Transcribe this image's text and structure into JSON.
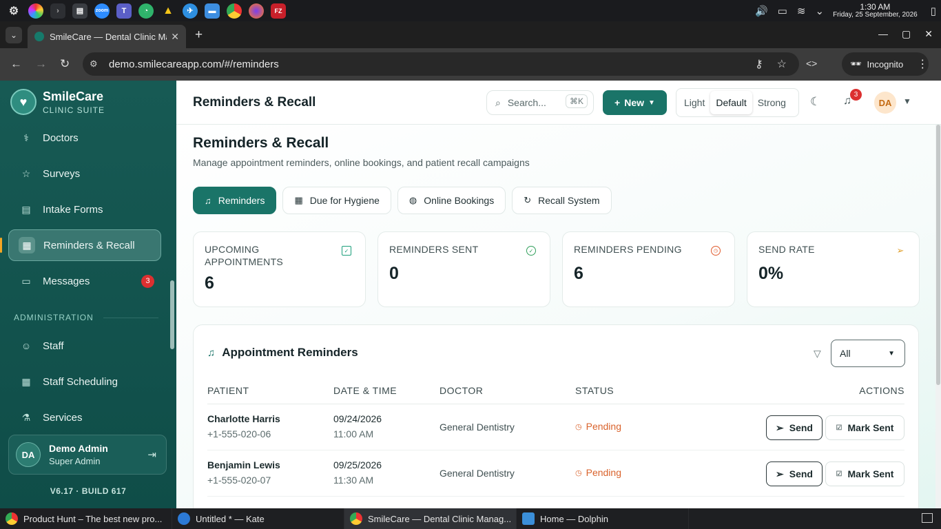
{
  "os": {
    "clock_time": "1:30 AM",
    "clock_date": "Friday, 25 September, 2026"
  },
  "browser": {
    "tab_title": "SmileCare — Dental Clinic Management",
    "url": "demo.smilecareapp.com/#/reminders",
    "incognito_label": "Incognito"
  },
  "sidebar": {
    "brand_name": "SmileCare",
    "brand_sub": "CLINIC SUITE",
    "items": [
      {
        "label": "Doctors",
        "icon": "stethoscope-icon"
      },
      {
        "label": "Surveys",
        "icon": "star-icon"
      },
      {
        "label": "Intake Forms",
        "icon": "clipboard-icon"
      },
      {
        "label": "Reminders & Recall",
        "icon": "calendar-check-icon",
        "active": true
      },
      {
        "label": "Messages",
        "icon": "message-icon",
        "badge": "3"
      }
    ],
    "section_admin": "ADMINISTRATION",
    "admin_items": [
      {
        "label": "Staff",
        "icon": "user-cog-icon"
      },
      {
        "label": "Staff Scheduling",
        "icon": "calendar-icon"
      },
      {
        "label": "Services",
        "icon": "flask-icon"
      }
    ],
    "user": {
      "initials": "DA",
      "name": "Demo Admin",
      "role": "Super Admin"
    },
    "version": "V6.17 · BUILD 617"
  },
  "header": {
    "title": "Reminders & Recall",
    "search_placeholder": "Search...",
    "search_shortcut": "⌘K",
    "new_label": "New",
    "theme_options": [
      "Light",
      "Default",
      "Strong"
    ],
    "theme_selected": "Default",
    "notifications_count": "3",
    "avatar_initials": "DA"
  },
  "page": {
    "title": "Reminders & Recall",
    "subtitle": "Manage appointment reminders, online bookings, and patient recall campaigns",
    "tabs": [
      {
        "label": "Reminders",
        "active": true
      },
      {
        "label": "Due for Hygiene"
      },
      {
        "label": "Online Bookings"
      },
      {
        "label": "Recall System"
      }
    ],
    "stats": [
      {
        "label": "UPCOMING APPOINTMENTS",
        "value": "6",
        "color": "#1a9e7a"
      },
      {
        "label": "REMINDERS SENT",
        "value": "0",
        "color": "#2f9e5a"
      },
      {
        "label": "REMINDERS PENDING",
        "value": "6",
        "color": "#e0592b"
      },
      {
        "label": "SEND RATE",
        "value": "0%",
        "color": "#e0a02b"
      }
    ]
  },
  "reminders_table": {
    "title": "Appointment Reminders",
    "filter_value": "All",
    "columns": [
      "PATIENT",
      "DATE & TIME",
      "DOCTOR",
      "STATUS",
      "ACTIONS"
    ],
    "rows": [
      {
        "name": "Charlotte Harris",
        "phone": "+1-555-020-06",
        "date": "09/24/2026",
        "time": "11:00 AM",
        "doctor": "General Dentistry",
        "status": "Pending"
      },
      {
        "name": "Benjamin Lewis",
        "phone": "+1-555-020-07",
        "date": "09/25/2026",
        "time": "11:30 AM",
        "doctor": "General Dentistry",
        "status": "Pending"
      }
    ],
    "send_label": "Send",
    "mark_label": "Mark Sent"
  },
  "taskbar": [
    {
      "label": "Product Hunt – The best new pro...",
      "color": "#e44d26"
    },
    {
      "label": "Untitled * — Kate",
      "color": "#2c7ad6"
    },
    {
      "label": "SmileCare — Dental Clinic Manag...",
      "color": "#e44d26",
      "active": true
    },
    {
      "label": "Home — Dolphin",
      "color": "#3b8fd9"
    }
  ]
}
